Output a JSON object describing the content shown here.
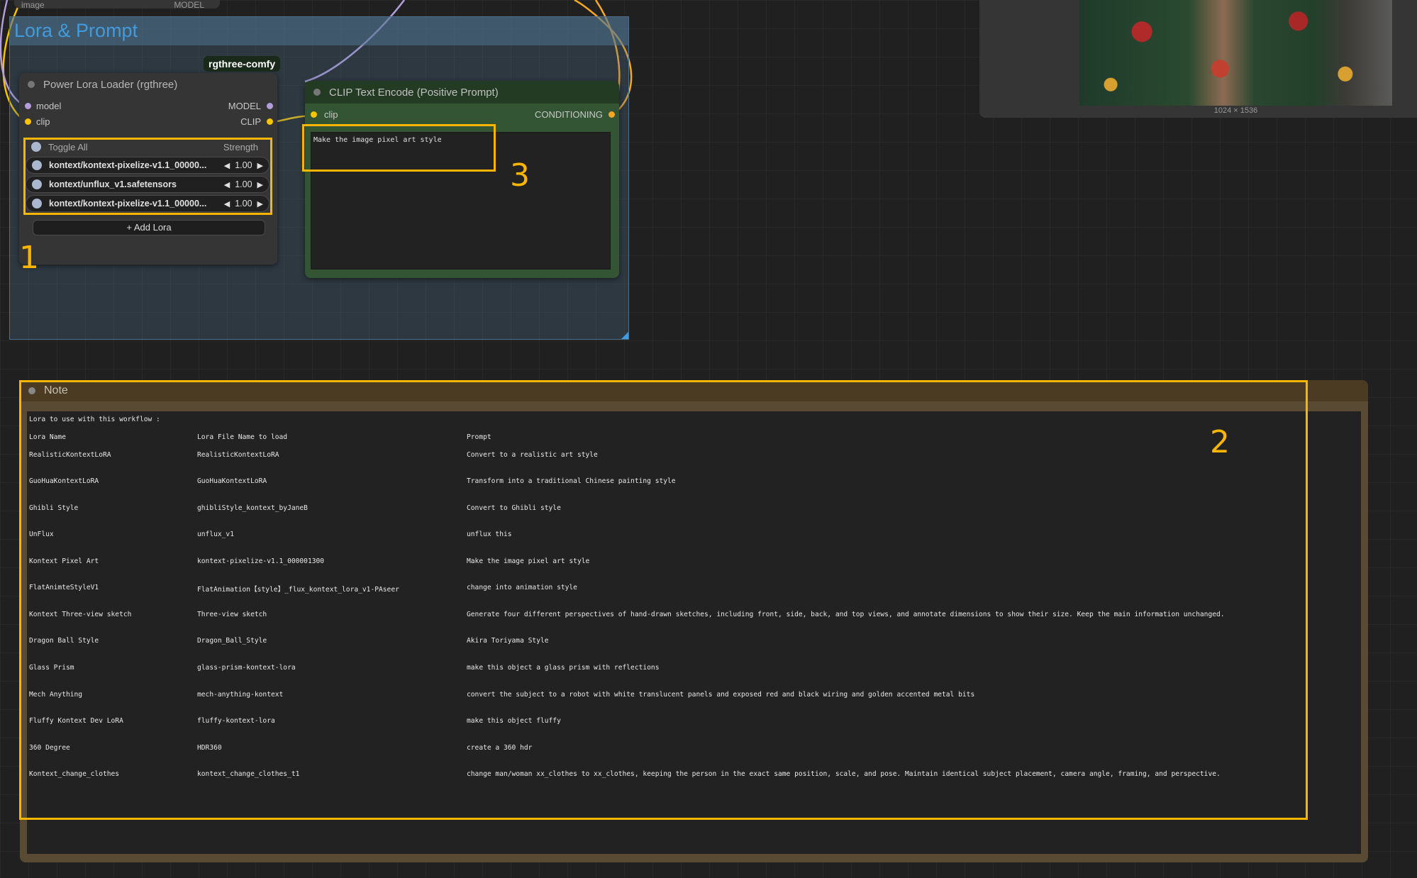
{
  "canvas_top": {
    "partial_node_left_label": "image",
    "partial_node_right_label": "MODEL"
  },
  "group": {
    "title": "Lora & Prompt"
  },
  "badge": "rgthree-comfy",
  "lora_loader": {
    "title": "Power Lora Loader (rgthree)",
    "inputs": [
      "model",
      "clip"
    ],
    "outputs": [
      "MODEL",
      "CLIP"
    ],
    "toggle_all": "Toggle All",
    "strength_header": "Strength",
    "loras": [
      {
        "name": "kontext/kontext-pixelize-v1.1_00000...",
        "strength": "1.00"
      },
      {
        "name": "kontext/unflux_v1.safetensors",
        "strength": "1.00"
      },
      {
        "name": "kontext/kontext-pixelize-v1.1_00000...",
        "strength": "1.00"
      }
    ],
    "add_lora": "Add Lora"
  },
  "clip_node": {
    "title": "CLIP Text Encode (Positive Prompt)",
    "input": "clip",
    "output": "CONDITIONING",
    "prompt": "Make the image pixel art style"
  },
  "preview": {
    "caption": "1024 × 1536"
  },
  "annotations": {
    "n1": "1",
    "n2": "2",
    "n3": "3"
  },
  "note": {
    "title": "Note",
    "intro": "Lora to use with this workflow :",
    "headers": [
      "Lora Name",
      "Lora File Name to load",
      "Prompt"
    ],
    "rows": [
      [
        "RealisticKontextLoRA",
        "RealisticKontextLoRA",
        "Convert to a realistic art style"
      ],
      [
        "GuoHuaKontextLoRA",
        "GuoHuaKontextLoRA",
        "Transform into a traditional Chinese painting style"
      ],
      [
        "Ghibli Style",
        "ghibliStyle_kontext_byJaneB",
        "Convert to Ghibli style"
      ],
      [
        "UnFlux",
        "unflux_v1",
        "unflux this"
      ],
      [
        "Kontext Pixel Art",
        "kontext-pixelize-v1.1_000001300",
        "Make the image pixel art style"
      ],
      [
        "FlatAnimteStyleV1",
        "FlatAnimation【style】_flux_kontext_lora_v1-PAseer",
        "change into animation style"
      ],
      [
        "Kontext Three-view sketch",
        "Three-view sketch",
        "Generate four different perspectives of hand-drawn sketches, including front, side, back, and top views, and annotate dimensions to show their size. Keep the main information unchanged."
      ],
      [
        "Dragon Ball Style",
        "Dragon_Ball_Style",
        "Akira Toriyama Style"
      ],
      [
        "Glass Prism",
        "glass-prism-kontext-lora",
        "make this object a glass prism with reflections"
      ],
      [
        "Mech Anything",
        "mech-anything-kontext",
        "convert the subject to a robot with white translucent panels and exposed red and black wiring and golden accented metal bits"
      ],
      [
        "Fluffy Kontext Dev LoRA",
        "fluffy-kontext-lora",
        "make this object fluffy"
      ],
      [
        "360 Degree",
        "HDR360",
        "create a 360 hdr"
      ],
      [
        "Kontext_change_clothes",
        "kontext_change_clothes_t1",
        "change man/woman xx_clothes to xx_clothes, keeping the person in the exact same position, scale, and pose. Maintain identical subject placement, camera angle, framing, and perspective."
      ]
    ]
  },
  "colors": {
    "highlight": "#f8b600",
    "group_title": "#3f9be0",
    "wire_clip": "#f8c300",
    "wire_model": "#b39ddb",
    "wire_conditioning": "#f5a623"
  }
}
